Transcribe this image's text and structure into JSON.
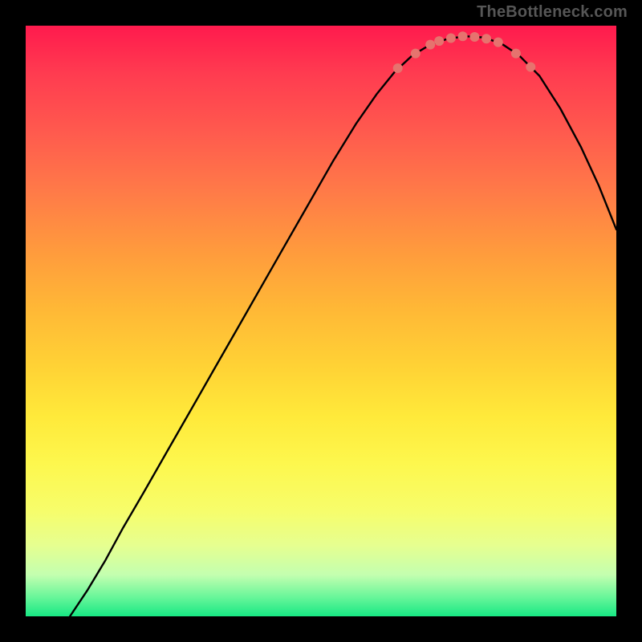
{
  "watermark": "TheBottleneck.com",
  "chart_data": {
    "type": "line",
    "title": "",
    "xlabel": "",
    "ylabel": "",
    "x_range_fraction": [
      0,
      1
    ],
    "y_range_fraction": [
      0,
      1
    ],
    "curve_fraction": [
      {
        "x": 0.075,
        "y": 0.0
      },
      {
        "x": 0.105,
        "y": 0.045
      },
      {
        "x": 0.135,
        "y": 0.095
      },
      {
        "x": 0.165,
        "y": 0.15
      },
      {
        "x": 0.2,
        "y": 0.21
      },
      {
        "x": 0.24,
        "y": 0.28
      },
      {
        "x": 0.28,
        "y": 0.35
      },
      {
        "x": 0.32,
        "y": 0.42
      },
      {
        "x": 0.36,
        "y": 0.49
      },
      {
        "x": 0.4,
        "y": 0.56
      },
      {
        "x": 0.44,
        "y": 0.63
      },
      {
        "x": 0.48,
        "y": 0.7
      },
      {
        "x": 0.52,
        "y": 0.77
      },
      {
        "x": 0.56,
        "y": 0.835
      },
      {
        "x": 0.595,
        "y": 0.885
      },
      {
        "x": 0.625,
        "y": 0.922
      },
      {
        "x": 0.655,
        "y": 0.95
      },
      {
        "x": 0.685,
        "y": 0.968
      },
      {
        "x": 0.715,
        "y": 0.978
      },
      {
        "x": 0.745,
        "y": 0.982
      },
      {
        "x": 0.775,
        "y": 0.98
      },
      {
        "x": 0.805,
        "y": 0.97
      },
      {
        "x": 0.835,
        "y": 0.95
      },
      {
        "x": 0.87,
        "y": 0.915
      },
      {
        "x": 0.905,
        "y": 0.86
      },
      {
        "x": 0.94,
        "y": 0.795
      },
      {
        "x": 0.97,
        "y": 0.73
      },
      {
        "x": 1.0,
        "y": 0.655
      }
    ],
    "dots_fraction": [
      {
        "x": 0.63,
        "y": 0.928
      },
      {
        "x": 0.66,
        "y": 0.953
      },
      {
        "x": 0.685,
        "y": 0.968
      },
      {
        "x": 0.7,
        "y": 0.974
      },
      {
        "x": 0.72,
        "y": 0.979
      },
      {
        "x": 0.74,
        "y": 0.982
      },
      {
        "x": 0.76,
        "y": 0.981
      },
      {
        "x": 0.78,
        "y": 0.978
      },
      {
        "x": 0.8,
        "y": 0.972
      },
      {
        "x": 0.83,
        "y": 0.953
      },
      {
        "x": 0.855,
        "y": 0.93
      }
    ],
    "colors": {
      "curve": "#000000",
      "dots": "#e6736e",
      "gradient_top": "#ff1a4d",
      "gradient_bottom": "#18e884"
    }
  }
}
